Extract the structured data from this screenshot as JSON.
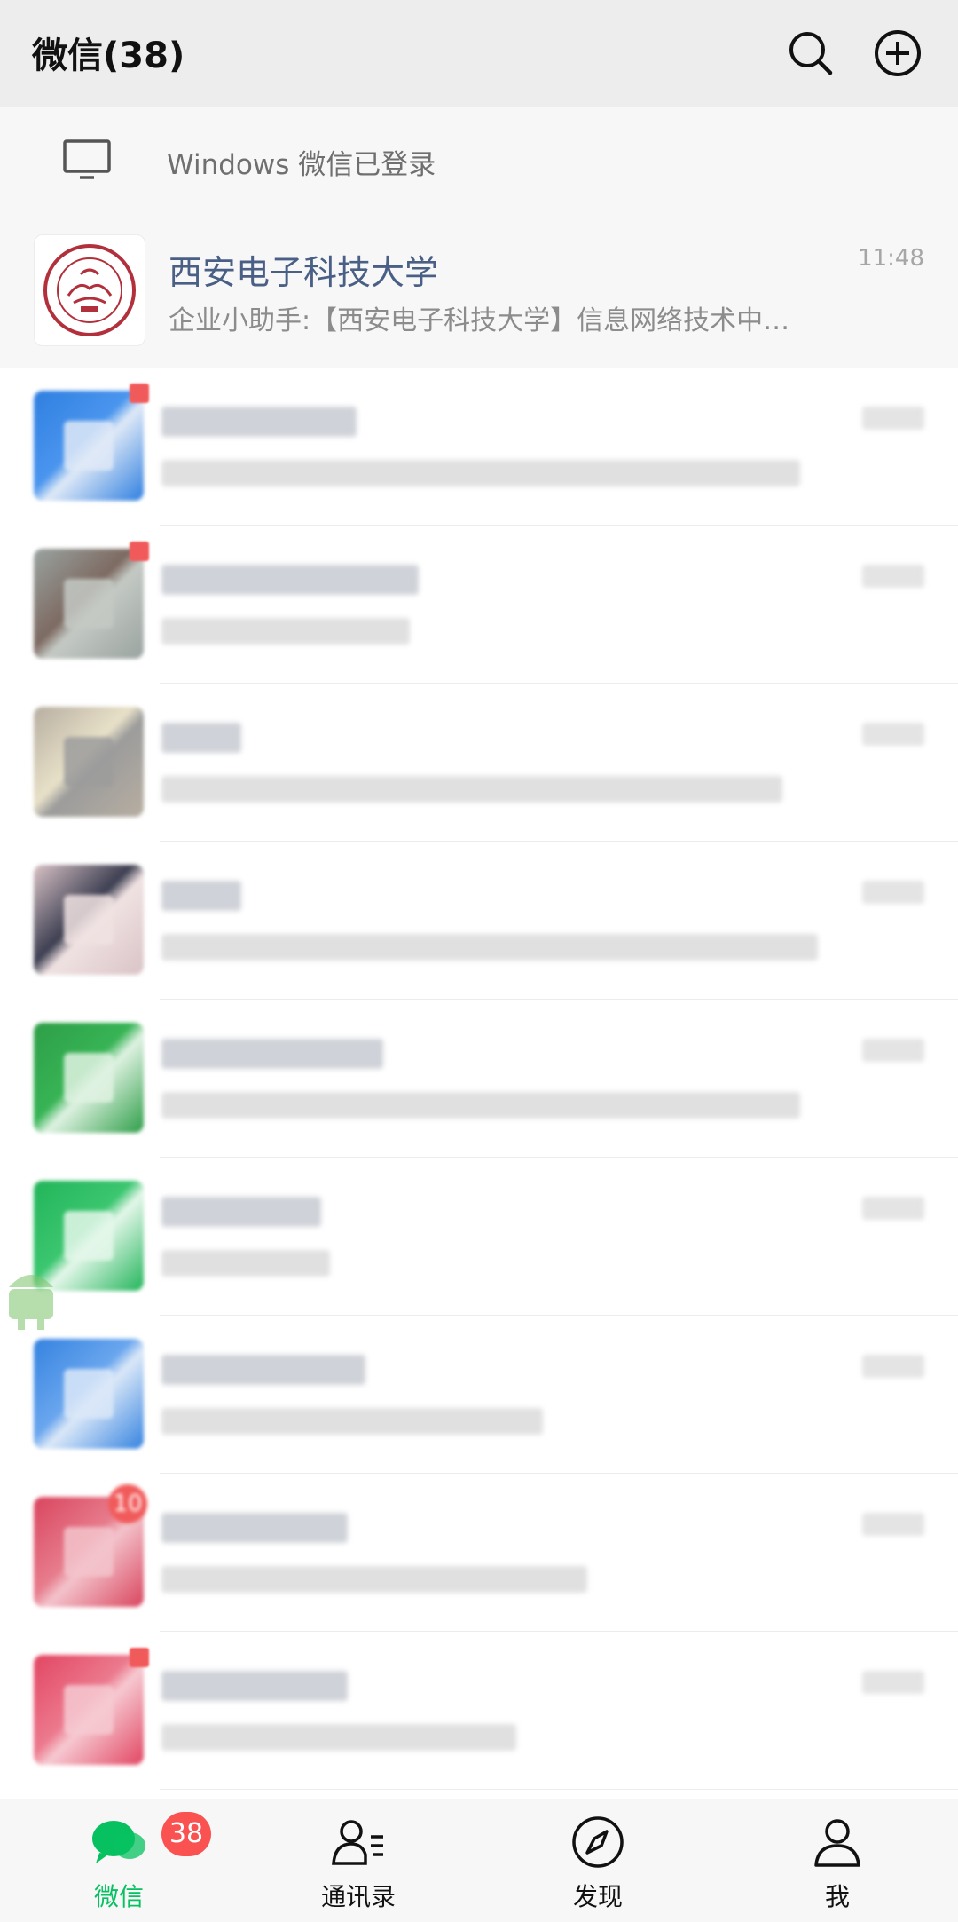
{
  "header": {
    "title": "微信(38)"
  },
  "login_bar": {
    "text": "Windows 微信已登录"
  },
  "pinned_chat": {
    "name": "西安电子科技大学",
    "time": "11:48",
    "preview": "企业小助手:【西安电子科技大学】信息网络技术中…",
    "avatar_text": "XIDIAN UNIVERSITY"
  },
  "tabbar": {
    "tabs": [
      {
        "label": "微信",
        "badge": "38",
        "active": true
      },
      {
        "label": "通讯录",
        "active": false
      },
      {
        "label": "发现",
        "active": false
      },
      {
        "label": "我",
        "active": false
      }
    ]
  },
  "colors": {
    "accent_green": "#07c160",
    "badge_red": "#fa5151",
    "link_blue": "#4a5f85"
  },
  "blurred_chats": [
    {
      "avatar_colors": [
        "#2f7fe0",
        "#4a95ee",
        "#dfe9f7"
      ],
      "unread_dot": true
    },
    {
      "avatar_colors": [
        "#9aa3a0",
        "#7d6a62",
        "#c4c9c4"
      ],
      "unread_dot": true
    },
    {
      "avatar_colors": [
        "#b7aea1",
        "#e8e1c8",
        "#9c9c9c"
      ],
      "unread_dot": false
    },
    {
      "avatar_colors": [
        "#d9c3c6",
        "#3d3f52",
        "#f0e2e2"
      ],
      "unread_dot": false
    },
    {
      "avatar_colors": [
        "#2e9e48",
        "#37b455",
        "#dff2e2"
      ],
      "unread_dot": false
    },
    {
      "avatar_colors": [
        "#22b55a",
        "#3bc66f",
        "#e4f7ea"
      ],
      "unread_dot": false
    },
    {
      "avatar_colors": [
        "#3583e0",
        "#6aa6ee",
        "#dbe8f8"
      ],
      "unread_dot": false
    },
    {
      "avatar_colors": [
        "#d9455e",
        "#e77d8d",
        "#f3c3cb"
      ],
      "unread_count": "10"
    },
    {
      "avatar_colors": [
        "#e24662",
        "#ec7a8e",
        "#f6c9d1"
      ],
      "unread_dot": true
    }
  ]
}
